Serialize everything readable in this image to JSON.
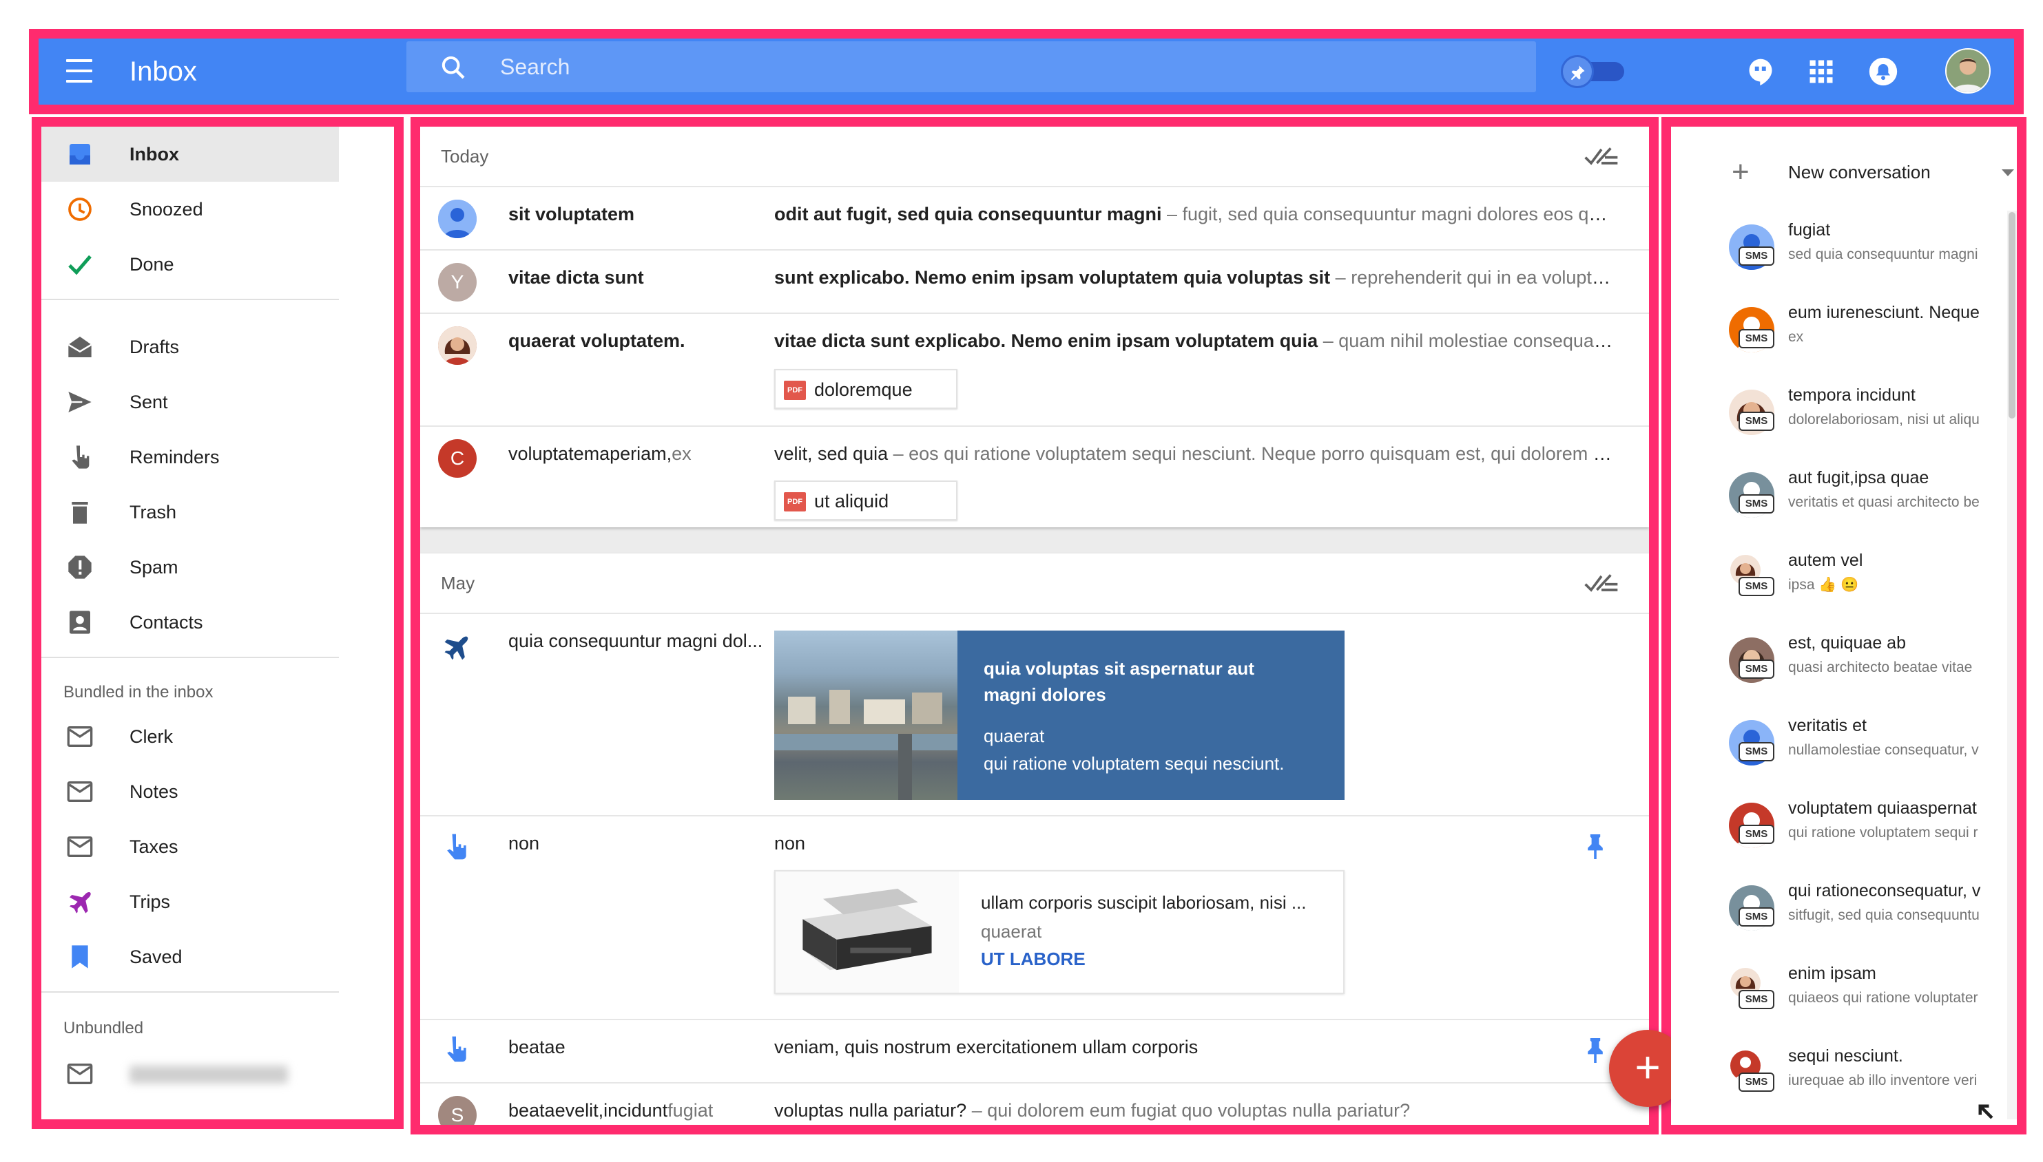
{
  "colors": {
    "brand": "#4285f4",
    "frame": "#ff2b6e",
    "fab": "#db4437",
    "link": "#2962c9"
  },
  "header": {
    "app_title": "Inbox",
    "search_placeholder": "Search",
    "icons": [
      "menu-icon",
      "search-icon",
      "pin-toggle",
      "hangouts-icon",
      "apps-grid-icon",
      "notifications-icon",
      "account-avatar"
    ]
  },
  "sidebar": {
    "primary": [
      {
        "label": "Inbox",
        "icon": "inbox-icon",
        "active": true
      },
      {
        "label": "Snoozed",
        "icon": "clock-icon"
      },
      {
        "label": "Done",
        "icon": "check-icon"
      }
    ],
    "secondary": [
      {
        "label": "Drafts",
        "icon": "drafts-icon"
      },
      {
        "label": "Sent",
        "icon": "send-icon"
      },
      {
        "label": "Reminders",
        "icon": "reminder-icon"
      },
      {
        "label": "Trash",
        "icon": "trash-icon"
      },
      {
        "label": "Spam",
        "icon": "spam-icon"
      },
      {
        "label": "Contacts",
        "icon": "contacts-icon"
      }
    ],
    "bundled_title": "Bundled in the inbox",
    "bundled": [
      {
        "label": "Clerk",
        "icon": "envelope-icon"
      },
      {
        "label": "Notes",
        "icon": "envelope-icon"
      },
      {
        "label": "Taxes",
        "icon": "envelope-icon"
      },
      {
        "label": "Trips",
        "icon": "plane-icon"
      },
      {
        "label": "Saved",
        "icon": "bookmark-icon"
      }
    ],
    "unbundled_title": "Unbundled"
  },
  "sections": [
    {
      "title": "Today",
      "rows": [
        {
          "sender": "sit voluptatem",
          "subject": "odit aut fugit, sed quia consequuntur magni",
          "snippet": " – fugit, sed quia consequuntur magni dolores eos qui ratione voluptatem"
        },
        {
          "sender": "vitae dicta sunt",
          "avatar_letter": "Y",
          "subject": "sunt explicabo. Nemo enim ipsam voluptatem quia voluptas sit",
          "snippet": " – reprehenderit qui in ea voluptate velit esse"
        },
        {
          "sender": "quaerat voluptatem.",
          "subject": "vitae dicta sunt explicabo. Nemo enim ipsam voluptatem quia",
          "snippet": " – quam nihil molestiae consequatur, vel illum",
          "attachment": "doloremque"
        },
        {
          "sender": "voluptatemaperiam,",
          "sender_extra": "ex",
          "avatar_letter": "C",
          "subject": "velit, sed quia",
          "snippet": " – eos qui ratione voluptatem sequi nesciunt. Neque porro quisquam est, qui dolorem ipsum",
          "attachment": "ut aliquid"
        }
      ]
    },
    {
      "title": "May",
      "rows": [
        {
          "sender": "quia consequuntur magni dol...",
          "trip": {
            "title": "quia voluptas sit aspernatur aut magni dolores",
            "line1": "quaerat",
            "line2": "qui ratione voluptatem sequi nesciunt."
          }
        },
        {
          "sender": "non",
          "subject": "non",
          "product": {
            "title": "ullam corporis suscipit laboriosam, nisi ...",
            "sub": "quaerat",
            "cta": "UT LABORE"
          }
        },
        {
          "sender": "beatae",
          "subject": "veniam, quis nostrum exercitationem ullam corporis"
        },
        {
          "sender": "beataevelit,incidunt",
          "sender_extra": "fugiat",
          "avatar_letter": "S",
          "subject": "voluptas nulla pariatur?",
          "snippet": " – qui dolorem eum fugiat quo voluptas nulla pariatur?"
        }
      ]
    }
  ],
  "fab_label": "+",
  "hangouts": {
    "new_conversation": "New conversation",
    "badge": "SMS",
    "conversations": [
      {
        "name": "fugiat",
        "message": "sed quia consequuntur magni"
      },
      {
        "name": "eum iurenesciunt. Neque",
        "message": "ex"
      },
      {
        "name": "tempora incidunt",
        "message": "dolorelaboriosam, nisi ut aliqu"
      },
      {
        "name": "aut fugit,ipsa quae",
        "message": "veritatis et quasi architecto be"
      },
      {
        "name": "autem vel",
        "message": "ipsa 👍 😐"
      },
      {
        "name": "est, quiquae ab",
        "message": "quasi architecto beatae vitae"
      },
      {
        "name": "veritatis et",
        "message": "nullamolestiae consequatur, v"
      },
      {
        "name": "voluptatem quiaaspernat",
        "message": "qui ratione voluptatem sequi r"
      },
      {
        "name": "qui rationeconsequatur, v",
        "message": "sitfugit, sed quia consequuntu"
      },
      {
        "name": "enim ipsam",
        "message": "quiaeos qui ratione voluptater"
      },
      {
        "name": "sequi nesciunt.",
        "message": "iurequae ab illo inventore veri"
      }
    ]
  }
}
